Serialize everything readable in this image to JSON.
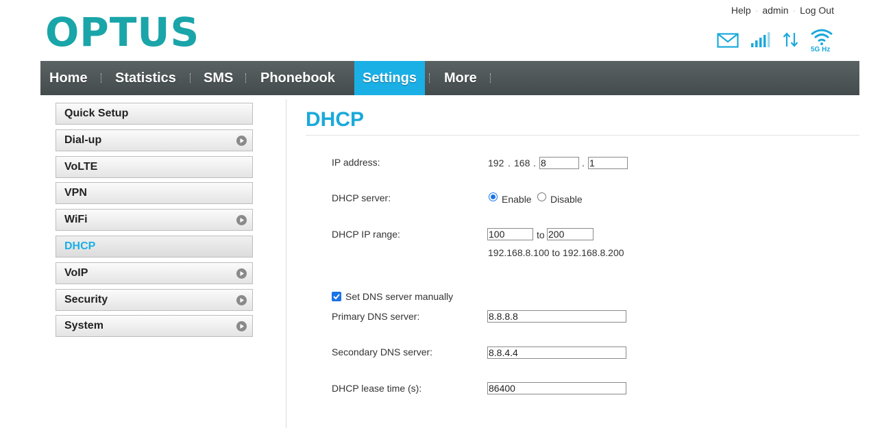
{
  "header": {
    "logo": "OPTUS",
    "links": {
      "help": "Help",
      "user": "admin",
      "logout": "Log Out"
    },
    "status": {
      "band": "5G Hz"
    }
  },
  "nav": {
    "items": [
      {
        "label": "Home"
      },
      {
        "label": "Statistics"
      },
      {
        "label": "SMS"
      },
      {
        "label": "Phonebook"
      },
      {
        "label": "Settings"
      },
      {
        "label": "More"
      }
    ],
    "active": "Settings",
    "active_color": "#1ab0e6"
  },
  "sidebar": {
    "items": [
      {
        "label": "Quick Setup",
        "has_arrow": false
      },
      {
        "label": "Dial-up",
        "has_arrow": true
      },
      {
        "label": "VoLTE",
        "has_arrow": false
      },
      {
        "label": "VPN",
        "has_arrow": false
      },
      {
        "label": "WiFi",
        "has_arrow": true
      },
      {
        "label": "DHCP",
        "has_arrow": false
      },
      {
        "label": "VoIP",
        "has_arrow": true
      },
      {
        "label": "Security",
        "has_arrow": true
      },
      {
        "label": "System",
        "has_arrow": true
      }
    ],
    "active": "DHCP"
  },
  "content": {
    "title": "DHCP",
    "ip_address": {
      "label": "IP address:",
      "octet1": "192",
      "octet2": "168",
      "octet3": "8",
      "octet4": "1",
      "dot": "."
    },
    "dhcp_server": {
      "label": "DHCP server:",
      "enable_label": "Enable",
      "disable_label": "Disable",
      "selected": "Enable"
    },
    "ip_range": {
      "label": "DHCP IP range:",
      "start": "100",
      "to_label": "to",
      "end": "200",
      "summary": "192.168.8.100 to 192.168.8.200"
    },
    "dns": {
      "manual_label": "Set DNS server manually",
      "manual_checked": true,
      "primary_label": "Primary DNS server:",
      "primary_value": "8.8.8.8",
      "secondary_label": "Secondary DNS server:",
      "secondary_value": "8.8.4.4"
    },
    "lease": {
      "label": "DHCP lease time (s):",
      "value": "86400"
    }
  }
}
